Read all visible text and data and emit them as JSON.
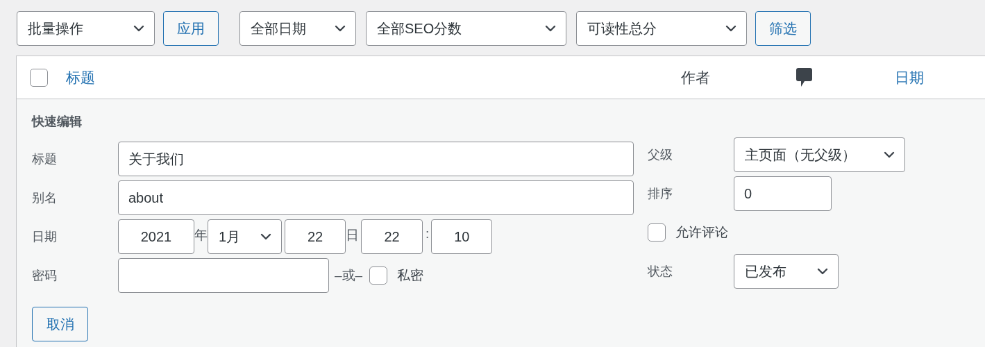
{
  "toolbar": [
    {
      "kind": "select",
      "value": "批量操作"
    },
    {
      "kind": "button",
      "label": "应用"
    },
    {
      "kind": "select",
      "value": "全部日期"
    },
    {
      "kind": "select",
      "value": "全部SEO分数"
    },
    {
      "kind": "select",
      "value": "可读性总分"
    },
    {
      "kind": "button",
      "label": "筛选"
    }
  ],
  "table": {
    "select_all": {
      "checked": false
    },
    "columns": {
      "title": "标题",
      "author": "作者",
      "date": "日期"
    }
  },
  "quick_edit": {
    "heading": "快速编辑",
    "title": {
      "label": "标题",
      "value": "关于我们"
    },
    "slug": {
      "label": "别名",
      "value": "about"
    },
    "date": {
      "label": "日期",
      "year": "2021",
      "year_unit": "年",
      "month": "1月",
      "day": "22",
      "day_unit": "日",
      "hour": "22",
      "separator": ":",
      "minute": "10"
    },
    "password": {
      "label": "密码",
      "or": "–或–",
      "private_label": "私密",
      "private_checked": false
    },
    "parent": {
      "label": "父级",
      "value": "主页面（无父级）"
    },
    "order": {
      "label": "排序",
      "value": "0"
    },
    "allow_comments": {
      "label": "允许评论",
      "checked": false
    },
    "status": {
      "label": "状态",
      "value": "已发布"
    },
    "cancel": "取消"
  }
}
